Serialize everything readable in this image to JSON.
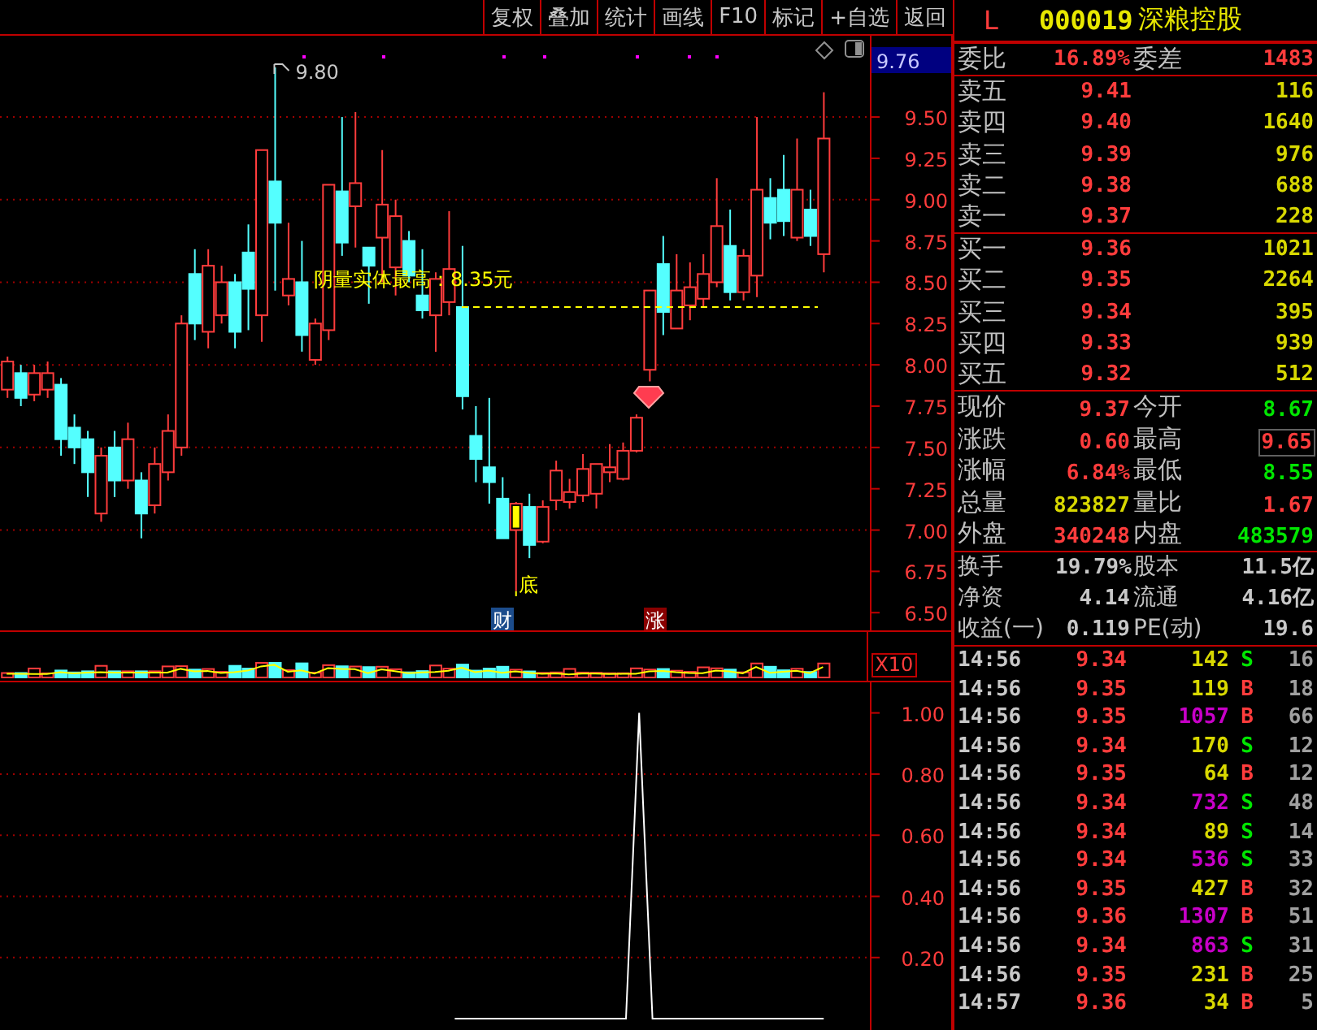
{
  "toolbar": {
    "buttons": [
      "复权",
      "叠加",
      "统计",
      "画线",
      "F10",
      "标记",
      "+自选",
      "返回"
    ]
  },
  "chart": {
    "current_price_tag": "9.76",
    "high_marker": "9.80",
    "annotation": "阴量实体最高：8.35元",
    "bottom_mark": {
      "label": "底",
      "color": "#ffff00"
    },
    "chart_data": {
      "type": "candlestick",
      "ylim": [
        6.393,
        9.992
      ],
      "categories": [
        null,
        null,
        null,
        null,
        null,
        null,
        null,
        null,
        null,
        null,
        null,
        null,
        null,
        null,
        null,
        null,
        null,
        null,
        null,
        null,
        null,
        null,
        null,
        null,
        null,
        null,
        null,
        null,
        null,
        null,
        null,
        null,
        null,
        null,
        null,
        null,
        null,
        null,
        null,
        null,
        null,
        null,
        null,
        null,
        null,
        null,
        null,
        null,
        null,
        null,
        null,
        null,
        null,
        null,
        null,
        null,
        null,
        null,
        null,
        null,
        null,
        null
      ],
      "ohlc": [
        [
          7.85,
          8.05,
          7.8,
          8.02
        ],
        [
          7.95,
          8.0,
          7.75,
          7.8
        ],
        [
          7.82,
          8.0,
          7.78,
          7.95
        ],
        [
          7.85,
          8.02,
          7.8,
          7.95
        ],
        [
          7.88,
          7.92,
          7.45,
          7.55
        ],
        [
          7.62,
          7.7,
          7.4,
          7.5
        ],
        [
          7.55,
          7.6,
          7.2,
          7.35
        ],
        [
          7.1,
          7.5,
          7.05,
          7.45
        ],
        [
          7.5,
          7.6,
          7.2,
          7.3
        ],
        [
          7.3,
          7.65,
          7.25,
          7.55
        ],
        [
          7.3,
          7.35,
          6.95,
          7.1
        ],
        [
          7.15,
          7.5,
          7.1,
          7.4
        ],
        [
          7.35,
          7.7,
          7.3,
          7.6
        ],
        [
          7.5,
          8.3,
          7.45,
          8.25
        ],
        [
          8.55,
          8.7,
          8.15,
          8.25
        ],
        [
          8.2,
          8.7,
          8.1,
          8.6
        ],
        [
          8.3,
          8.6,
          8.25,
          8.5
        ],
        [
          8.5,
          8.55,
          8.1,
          8.2
        ],
        [
          8.68,
          8.85,
          8.21,
          8.46
        ],
        [
          8.3,
          9.3,
          8.14,
          9.3
        ],
        [
          9.11,
          9.8,
          8.45,
          8.86
        ],
        [
          8.42,
          8.86,
          8.36,
          8.52
        ],
        [
          8.5,
          8.75,
          8.08,
          8.18
        ],
        [
          8.03,
          8.28,
          8.0,
          8.25
        ],
        [
          8.21,
          9.09,
          8.15,
          9.09
        ],
        [
          9.05,
          9.5,
          8.66,
          8.74
        ],
        [
          8.96,
          9.53,
          8.71,
          9.1
        ],
        [
          8.71,
          8.71,
          8.37,
          8.6
        ],
        [
          8.77,
          9.3,
          8.5,
          8.97
        ],
        [
          8.59,
          9.0,
          8.42,
          8.9
        ],
        [
          8.75,
          8.81,
          8.5,
          8.54
        ],
        [
          8.42,
          8.7,
          8.28,
          8.33
        ],
        [
          8.3,
          8.56,
          8.08,
          8.52
        ],
        [
          8.38,
          8.93,
          8.3,
          8.58
        ],
        [
          8.35,
          8.72,
          7.73,
          7.81
        ],
        [
          7.57,
          7.75,
          7.29,
          7.43
        ],
        [
          7.38,
          7.8,
          7.16,
          7.29
        ],
        [
          7.19,
          7.32,
          6.95,
          6.95
        ],
        [
          7.0,
          7.17,
          6.63,
          7.16
        ],
        [
          7.14,
          7.22,
          6.83,
          6.91
        ],
        [
          6.93,
          7.18,
          6.92,
          7.14
        ],
        [
          7.18,
          7.42,
          7.12,
          7.36
        ],
        [
          7.17,
          7.31,
          7.13,
          7.23
        ],
        [
          7.21,
          7.46,
          7.17,
          7.37
        ],
        [
          7.22,
          7.4,
          7.13,
          7.4
        ],
        [
          7.35,
          7.52,
          7.29,
          7.38
        ],
        [
          7.31,
          7.53,
          7.3,
          7.48
        ],
        [
          7.48,
          7.7,
          7.47,
          7.68
        ],
        [
          7.97,
          8.45,
          7.9,
          8.45
        ],
        [
          8.61,
          8.78,
          8.18,
          8.32
        ],
        [
          8.22,
          8.67,
          8.22,
          8.45
        ],
        [
          8.36,
          8.62,
          8.27,
          8.47
        ],
        [
          8.4,
          8.67,
          8.35,
          8.55
        ],
        [
          8.5,
          9.13,
          8.47,
          8.84
        ],
        [
          8.72,
          8.94,
          8.39,
          8.44
        ],
        [
          8.44,
          8.7,
          8.39,
          8.66
        ],
        [
          8.54,
          9.5,
          8.41,
          9.06
        ],
        [
          9.01,
          9.13,
          8.76,
          8.86
        ],
        [
          9.06,
          9.27,
          8.78,
          8.87
        ],
        [
          8.77,
          9.37,
          8.75,
          9.06
        ],
        [
          8.94,
          9.06,
          8.72,
          8.78
        ],
        [
          8.67,
          9.65,
          8.56,
          9.37
        ]
      ],
      "yticks": [
        {
          "value": 9.5,
          "label": "9.50"
        },
        {
          "value": 9.25,
          "label": "9.25"
        },
        {
          "value": 9.0,
          "label": "9.00"
        },
        {
          "value": 8.75,
          "label": "8.75"
        },
        {
          "value": 8.5,
          "label": "8.50"
        },
        {
          "value": 8.25,
          "label": "8.25"
        },
        {
          "value": 8.0,
          "label": "8.00"
        },
        {
          "value": 7.75,
          "label": "7.75"
        },
        {
          "value": 7.5,
          "label": "7.50"
        },
        {
          "value": 7.25,
          "label": "7.25"
        },
        {
          "value": 7.0,
          "label": "7.00"
        },
        {
          "value": 6.75,
          "label": "6.75"
        },
        {
          "value": 6.5,
          "label": "6.50"
        }
      ],
      "grid": true
    },
    "events": [
      {
        "label": "财",
        "kind": "finance"
      },
      {
        "label": "涨",
        "kind": "limit_up"
      }
    ]
  },
  "volume": {
    "scale_label": "X10"
  },
  "indicator": {
    "chart_data": {
      "type": "line",
      "ylim": [
        -0.037,
        1.1
      ],
      "grid": true,
      "yticks": [
        {
          "value": 1,
          "label": "1.00"
        },
        {
          "value": 0.8,
          "label": "0.80"
        },
        {
          "value": 0.6,
          "label": "0.60"
        },
        {
          "value": 0.4,
          "label": "0.40"
        },
        {
          "value": 0.2,
          "label": "0.20"
        }
      ],
      "series": [
        {
          "color": "#ffffff",
          "values": [
            null,
            null,
            null,
            null,
            null,
            null,
            null,
            null,
            null,
            null,
            null,
            null,
            null,
            null,
            null,
            null,
            null,
            null,
            null,
            null,
            null,
            null,
            null,
            null,
            null,
            null,
            null,
            null,
            null,
            null,
            null,
            null,
            null,
            null,
            0,
            0,
            0,
            0,
            0,
            0,
            0,
            0,
            0,
            0,
            0,
            0,
            0,
            0,
            1,
            0,
            0,
            0,
            0,
            0,
            0,
            0,
            0,
            0,
            0,
            0,
            0,
            0,
            0,
            null,
            null,
            null
          ]
        }
      ]
    }
  },
  "quote": {
    "flag": "L",
    "code": "000019",
    "name": "深粮控股",
    "order_book_summary": [
      {
        "label": "委比",
        "value": "16.89%"
      },
      {
        "label": "委差",
        "value": "1483"
      }
    ],
    "asks": [
      {
        "label": "卖五",
        "price": "9.41",
        "volume": "116"
      },
      {
        "label": "卖四",
        "price": "9.40",
        "volume": "1640"
      },
      {
        "label": "卖三",
        "price": "9.39",
        "volume": "976"
      },
      {
        "label": "卖二",
        "price": "9.38",
        "volume": "688"
      },
      {
        "label": "卖一",
        "price": "9.37",
        "volume": "228"
      }
    ],
    "bids": [
      {
        "label": "买一",
        "price": "9.36",
        "volume": "1021"
      },
      {
        "label": "买二",
        "price": "9.35",
        "volume": "2264"
      },
      {
        "label": "买三",
        "price": "9.34",
        "volume": "395"
      },
      {
        "label": "买四",
        "price": "9.33",
        "volume": "939"
      },
      {
        "label": "买五",
        "price": "9.32",
        "volume": "512"
      }
    ],
    "stats": [
      {
        "label": "现价",
        "value": "9.37",
        "color": "#ff3c3c",
        "highlighted": false
      },
      {
        "label": "今开",
        "value": "8.67",
        "color": "#00e600",
        "highlighted": false
      },
      {
        "label": "涨跌",
        "value": "0.60",
        "color": "#ff3c3c",
        "highlighted": false
      },
      {
        "label": "最高",
        "value": "9.65",
        "color": "#ff3c3c",
        "highlighted": true
      },
      {
        "label": "涨幅",
        "value": "6.84%",
        "color": "#ff3c3c",
        "highlighted": false
      },
      {
        "label": "最低",
        "value": "8.55",
        "color": "#00e600",
        "highlighted": false
      },
      {
        "label": "总量",
        "value": "823827",
        "color": "#d8d800",
        "highlighted": false
      },
      {
        "label": "量比",
        "value": "1.67",
        "color": "#ff3c3c",
        "highlighted": false
      },
      {
        "label": "外盘",
        "value": "340248",
        "color": "#ff3c3c",
        "highlighted": false
      },
      {
        "label": "内盘",
        "value": "483579",
        "color": "#00e600",
        "highlighted": false
      }
    ],
    "fundamentals": [
      {
        "label": "换手",
        "value": "19.79%"
      },
      {
        "label": "股本",
        "value": "11.5亿"
      },
      {
        "label": "净资",
        "value": "4.14"
      },
      {
        "label": "流通",
        "value": "4.16亿"
      },
      {
        "label": "收益(一)",
        "value": "0.119"
      },
      {
        "label": "PE(动)",
        "value": "19.6"
      }
    ]
  },
  "trades": [
    {
      "time": "14:56",
      "price": "9.34",
      "volume": "142",
      "large": false,
      "side": "S",
      "color": "#00e600",
      "count": "16"
    },
    {
      "time": "14:56",
      "price": "9.35",
      "volume": "119",
      "large": false,
      "side": "B",
      "color": "#ff3c3c",
      "count": "18"
    },
    {
      "time": "14:56",
      "price": "9.35",
      "volume": "1057",
      "large": true,
      "side": "B",
      "color": "#ff3c3c",
      "count": "66"
    },
    {
      "time": "14:56",
      "price": "9.34",
      "volume": "170",
      "large": false,
      "side": "S",
      "color": "#00e600",
      "count": "12"
    },
    {
      "time": "14:56",
      "price": "9.35",
      "volume": "64",
      "large": false,
      "side": "B",
      "color": "#ff3c3c",
      "count": "12"
    },
    {
      "time": "14:56",
      "price": "9.34",
      "volume": "732",
      "large": true,
      "side": "S",
      "color": "#00e600",
      "count": "48"
    },
    {
      "time": "14:56",
      "price": "9.34",
      "volume": "89",
      "large": false,
      "side": "S",
      "color": "#00e600",
      "count": "14"
    },
    {
      "time": "14:56",
      "price": "9.34",
      "volume": "536",
      "large": true,
      "side": "S",
      "color": "#00e600",
      "count": "33"
    },
    {
      "time": "14:56",
      "price": "9.35",
      "volume": "427",
      "large": false,
      "side": "B",
      "color": "#ff3c3c",
      "count": "32"
    },
    {
      "time": "14:56",
      "price": "9.36",
      "volume": "1307",
      "large": true,
      "side": "B",
      "color": "#ff3c3c",
      "count": "51"
    },
    {
      "time": "14:56",
      "price": "9.34",
      "volume": "863",
      "large": true,
      "side": "S",
      "color": "#00e600",
      "count": "31"
    },
    {
      "time": "14:56",
      "price": "9.35",
      "volume": "231",
      "large": false,
      "side": "B",
      "color": "#ff3c3c",
      "count": "25"
    },
    {
      "time": "14:57",
      "price": "9.36",
      "volume": "34",
      "large": false,
      "side": "B",
      "color": "#ff3c3c",
      "count": "5"
    }
  ]
}
